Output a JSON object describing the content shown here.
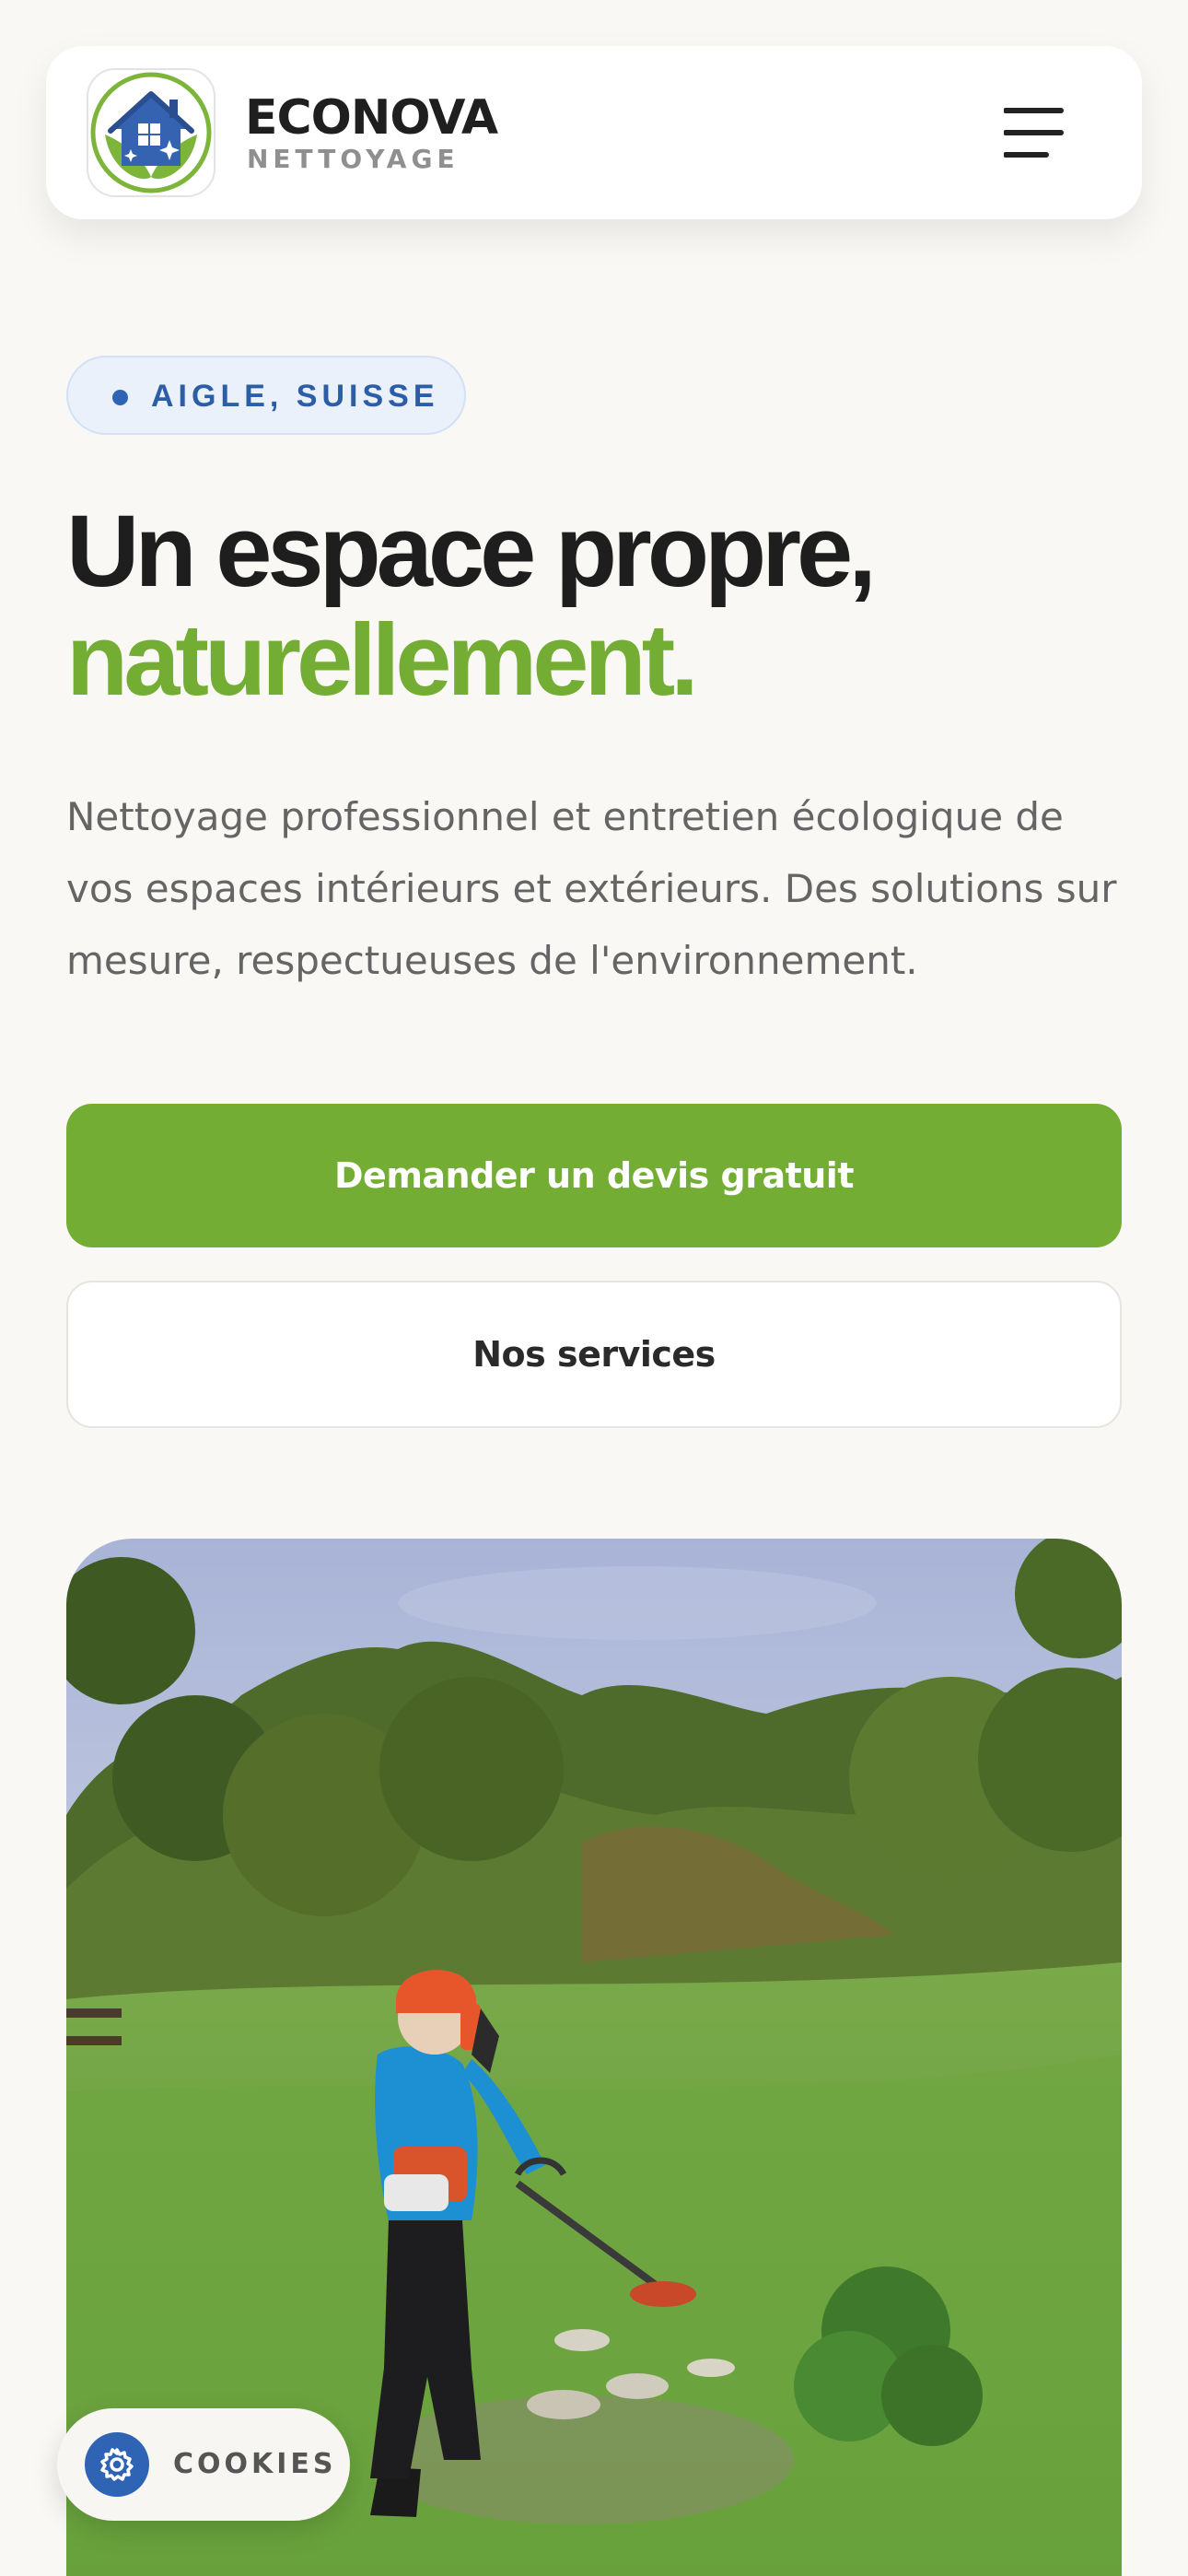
{
  "header": {
    "logo_icon": "house-leaf-logo-icon",
    "brand_name": "ECONOVA",
    "brand_subtitle": "NETTOYAGE",
    "menu_icon": "hamburger-menu-icon"
  },
  "hero": {
    "location_badge": "AIGLE, SUISSE",
    "title_line1": "Un espace propre,",
    "title_line2": "naturellement.",
    "description": "Nettoyage professionnel et entretien écologique de vos espaces intérieurs et extérieurs. Des solutions sur mesure, respectueuses de l'environnement.",
    "primary_cta": "Demander un devis gratuit",
    "secondary_cta": "Nos services",
    "photo": "photo of a gardener trimming grass with a string trimmer in a green garden"
  },
  "cookie_banner": {
    "label": "COOKIES",
    "icon": "cookie-settings-icon"
  },
  "colors": {
    "brand_green": "#74ad34",
    "brand_blue": "#2f64b4",
    "background": "#f9f8f5",
    "text_dark": "#1e1e1e",
    "text_muted": "#656565"
  }
}
